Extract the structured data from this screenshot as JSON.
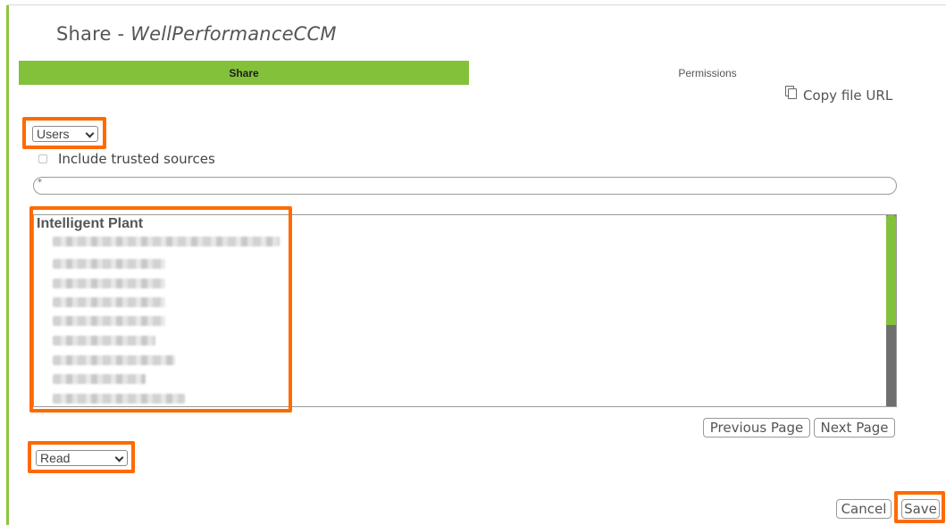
{
  "dialog": {
    "title_prefix": "Share - ",
    "title_name": "WellPerformanceCCM"
  },
  "tabs": [
    {
      "label": "Share",
      "active": true
    },
    {
      "label": "Permissions",
      "active": false
    }
  ],
  "copy_url": {
    "label": "Copy file URL",
    "icon": "copy-icon"
  },
  "principal_type": {
    "selected": "Users"
  },
  "include_trusted": {
    "label": "Include trusted sources",
    "checked": false
  },
  "filter": {
    "value": "*"
  },
  "user_list": {
    "group_name": "Intelligent Plant",
    "rows_redacted": true,
    "row_count": 9
  },
  "pagination": {
    "previous_label": "Previous Page",
    "next_label": "Next Page"
  },
  "permission": {
    "selected": "Read"
  },
  "actions": {
    "cancel_label": "Cancel",
    "save_label": "Save"
  },
  "colors": {
    "accent_green": "#84c13b",
    "highlight_orange": "#ff6a00",
    "scroll_track": "#6f6f6f"
  }
}
